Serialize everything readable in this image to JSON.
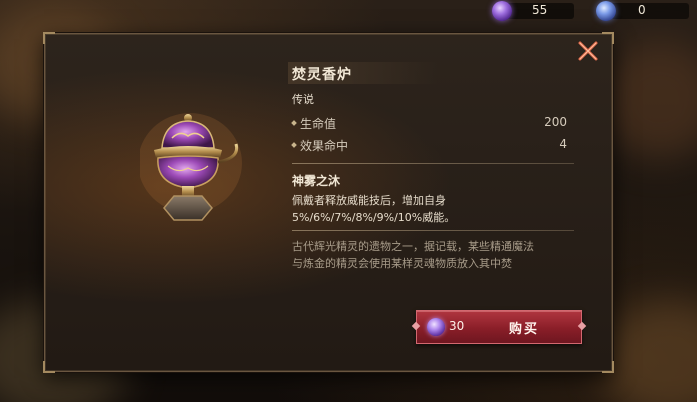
{
  "currency": {
    "gems": "55",
    "tokens": "0"
  },
  "item": {
    "name": "焚灵香炉",
    "rarity": "传说",
    "stats": [
      {
        "label": "生命值",
        "value": "200"
      },
      {
        "label": "效果命中",
        "value": "4"
      }
    ],
    "skill_name": "神雾之沐",
    "skill_desc_line1": "佩戴者释放威能技后，增加自身",
    "skill_desc_line2": "5%/6%/7%/8%/9%/10%威能。",
    "lore_line1": "古代辉光精灵的遗物之一，据记载，某些精通魔法",
    "lore_line2": "与炼金的精灵会使用某样灵魂物质放入其中焚"
  },
  "buy": {
    "price": "30",
    "label": "购买"
  },
  "colors": {
    "accent_red": "#8a1e28",
    "gold": "#a48a60",
    "gem_purple": "#a070e0"
  },
  "icons": {
    "gem": "purple-gem-icon",
    "token": "blue-token-icon",
    "close": "close-x-icon",
    "item": "incense-burner-icon"
  }
}
